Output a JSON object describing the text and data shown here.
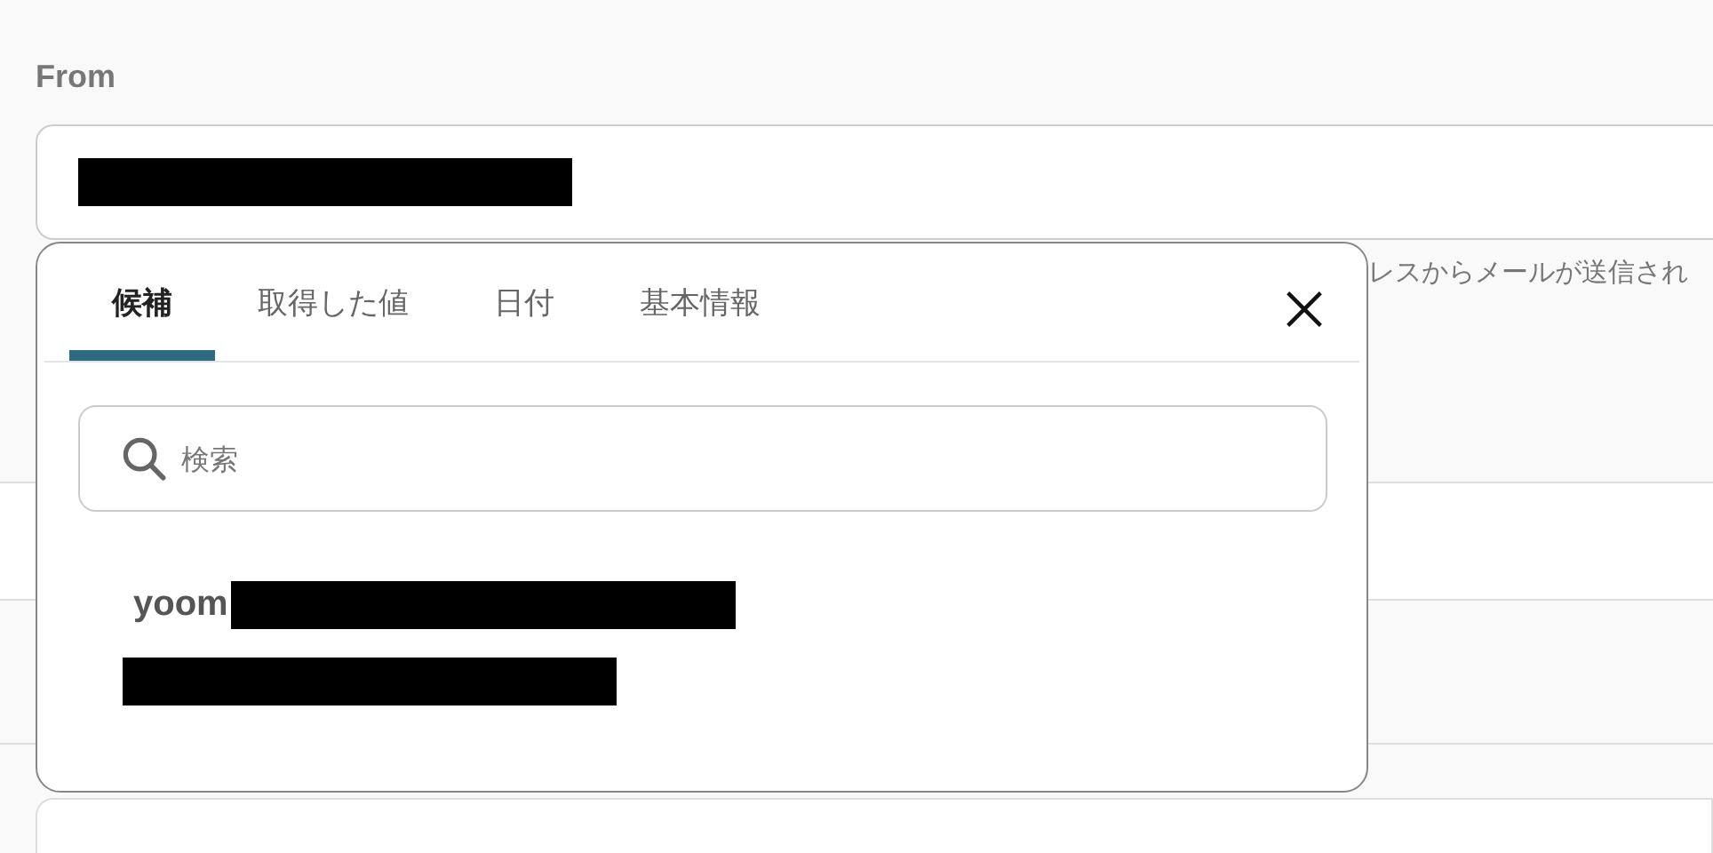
{
  "field": {
    "label": "From",
    "help_text": "レスからメールが送信され"
  },
  "picker": {
    "tabs": [
      {
        "label": "候補",
        "selected": true
      },
      {
        "label": "取得した値",
        "selected": false
      },
      {
        "label": "日付",
        "selected": false
      },
      {
        "label": "基本情報",
        "selected": false
      }
    ],
    "search": {
      "placeholder": "検索"
    },
    "items": [
      {
        "name": "yoom"
      }
    ]
  }
}
